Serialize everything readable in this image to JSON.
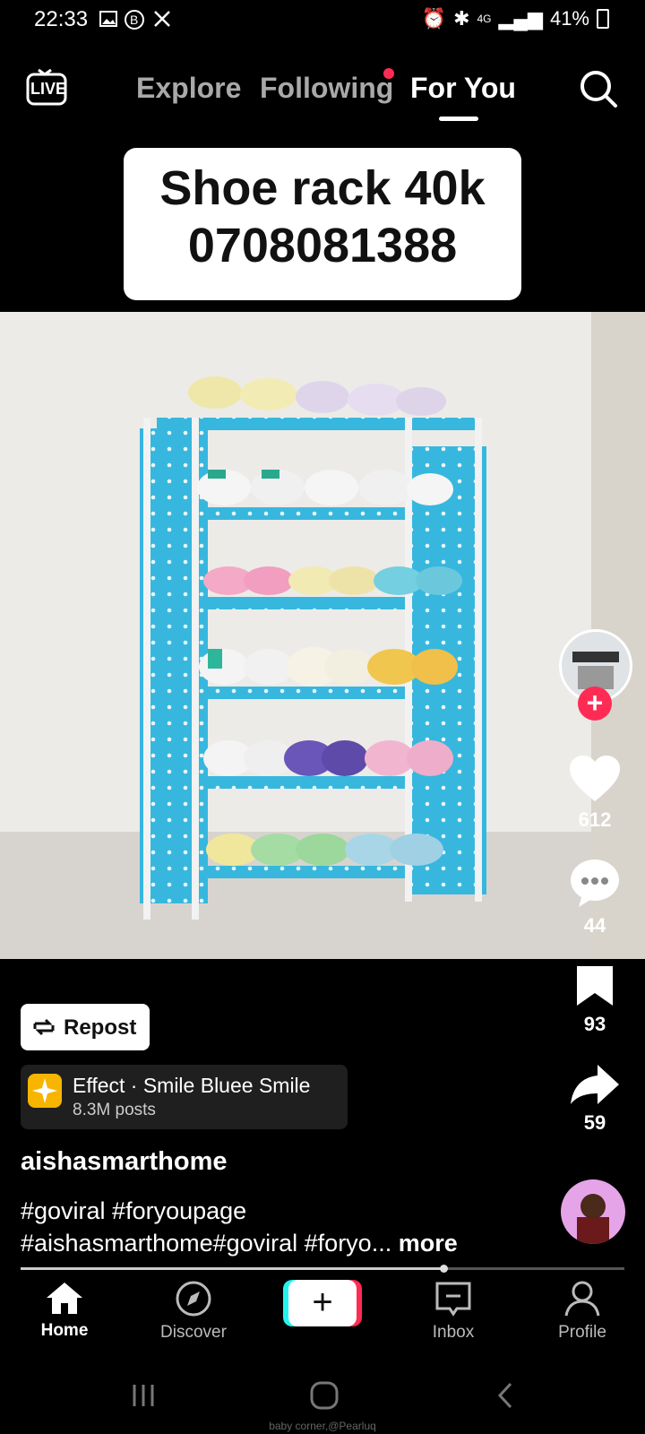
{
  "status_bar": {
    "time": "22:33",
    "battery": "41%",
    "signal": "4G"
  },
  "top_nav": {
    "live_label": "LIVE",
    "tabs": [
      {
        "label": "Explore"
      },
      {
        "label": "Following"
      },
      {
        "label": "For You"
      }
    ],
    "active_tab": "For You",
    "accent_color": "#fe2c55"
  },
  "banner": {
    "line1": "Shoe rack 40k",
    "line2": "0708081388"
  },
  "actions": {
    "likes": "612",
    "comments": "44",
    "saves": "93",
    "shares": "59"
  },
  "repost": {
    "label": "Repost"
  },
  "effect": {
    "title": "Effect · Smile Bluee Smile",
    "subtitle": "8.3M posts"
  },
  "post": {
    "username": "aishasmarthome",
    "caption_line1": "#goviral #foryoupage",
    "caption_line2": "#aishasmarthome#goviral #foryo...",
    "more": "more",
    "progress": 0.7
  },
  "bottom_nav": {
    "items": [
      {
        "label": "Home"
      },
      {
        "label": "Discover"
      },
      {
        "label": "Inbox"
      },
      {
        "label": "Profile"
      }
    ]
  },
  "watermark": "baby corner,@Pearluq"
}
